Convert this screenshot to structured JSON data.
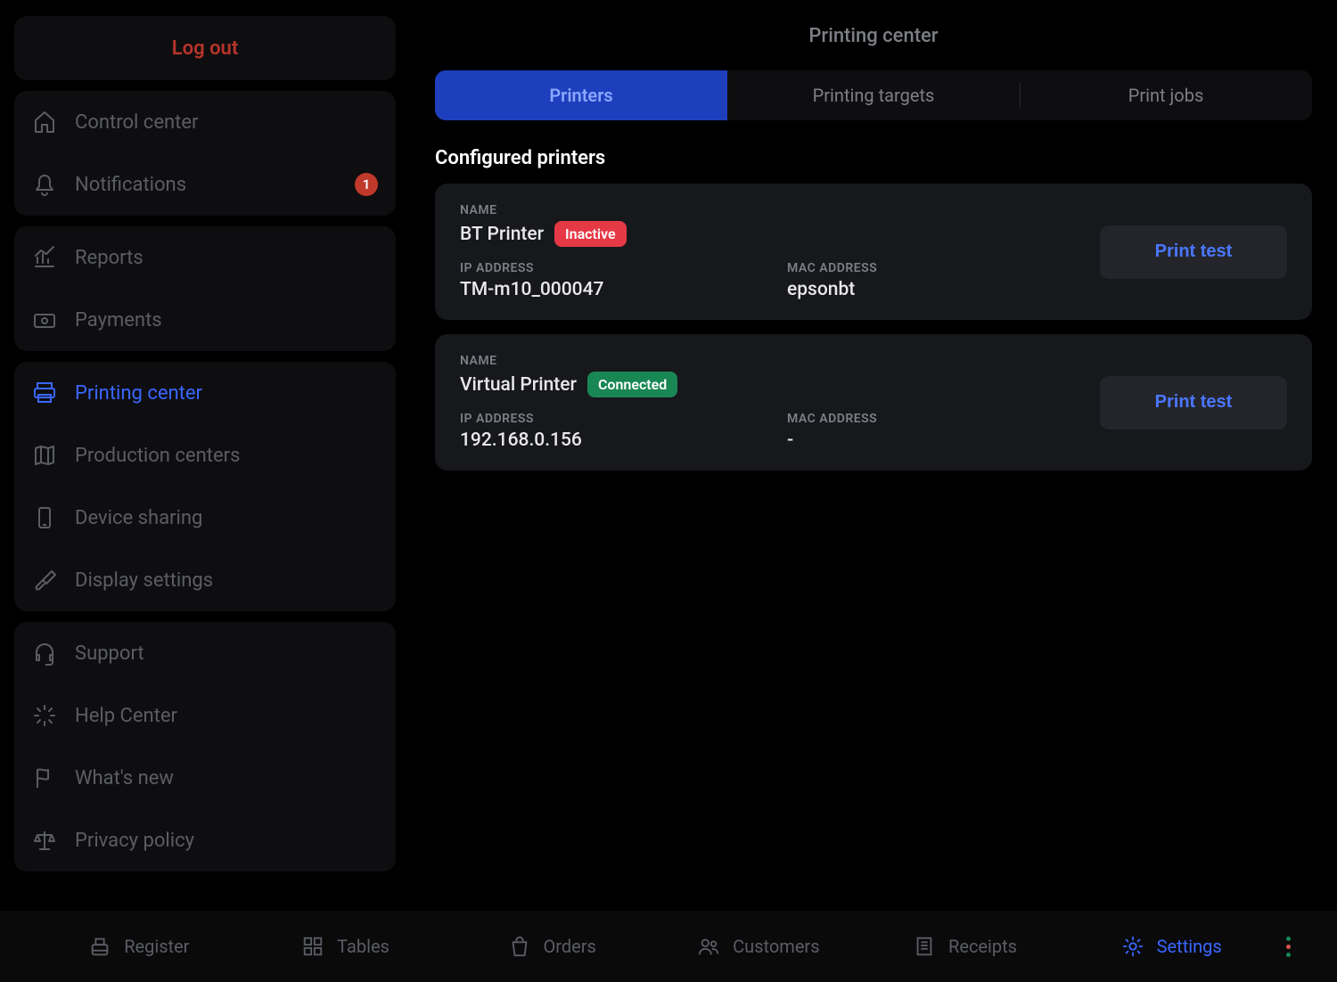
{
  "sidebar": {
    "logout_label": "Log out",
    "groups": [
      {
        "items": [
          {
            "key": "control-center",
            "label": "Control center",
            "icon": "home-icon"
          },
          {
            "key": "notifications",
            "label": "Notifications",
            "icon": "bell-icon",
            "badge": "1"
          }
        ]
      },
      {
        "items": [
          {
            "key": "reports",
            "label": "Reports",
            "icon": "chart-icon"
          },
          {
            "key": "payments",
            "label": "Payments",
            "icon": "cash-icon"
          }
        ]
      },
      {
        "items": [
          {
            "key": "printing-center",
            "label": "Printing center",
            "icon": "printer-icon",
            "active": true
          },
          {
            "key": "production-centers",
            "label": "Production centers",
            "icon": "map-icon"
          },
          {
            "key": "device-sharing",
            "label": "Device sharing",
            "icon": "phone-icon"
          },
          {
            "key": "display-settings",
            "label": "Display settings",
            "icon": "brush-icon"
          }
        ]
      },
      {
        "items": [
          {
            "key": "support",
            "label": "Support",
            "icon": "headset-icon"
          },
          {
            "key": "help-center",
            "label": "Help Center",
            "icon": "compass-icon"
          },
          {
            "key": "whats-new",
            "label": "What's new",
            "icon": "flag-icon"
          },
          {
            "key": "privacy-policy",
            "label": "Privacy policy",
            "icon": "scale-icon"
          }
        ]
      }
    ]
  },
  "header": {
    "title": "Printing center"
  },
  "tabs": [
    {
      "key": "printers",
      "label": "Printers",
      "active": true
    },
    {
      "key": "printing-targets",
      "label": "Printing targets"
    },
    {
      "key": "print-jobs",
      "label": "Print jobs"
    }
  ],
  "section": {
    "heading": "Configured printers"
  },
  "labels": {
    "name": "NAME",
    "ip": "IP ADDRESS",
    "mac": "MAC ADDRESS",
    "print_test": "Print test"
  },
  "printers": [
    {
      "name": "BT Printer",
      "status_text": "Inactive",
      "status": "inactive",
      "ip": "TM-m10_000047",
      "mac": "epsonbt"
    },
    {
      "name": "Virtual Printer",
      "status_text": "Connected",
      "status": "connected",
      "ip": "192.168.0.156",
      "mac": "-"
    }
  ],
  "bottombar": {
    "items": [
      {
        "key": "register",
        "label": "Register",
        "icon": "register-icon"
      },
      {
        "key": "tables",
        "label": "Tables",
        "icon": "grid-icon"
      },
      {
        "key": "orders",
        "label": "Orders",
        "icon": "bag-icon"
      },
      {
        "key": "customers",
        "label": "Customers",
        "icon": "users-icon"
      },
      {
        "key": "receipts",
        "label": "Receipts",
        "icon": "receipt-icon"
      },
      {
        "key": "settings",
        "label": "Settings",
        "icon": "gear-icon",
        "active": true
      }
    ],
    "status_dots": [
      "#198754",
      "#d9534f",
      "#198754"
    ]
  }
}
